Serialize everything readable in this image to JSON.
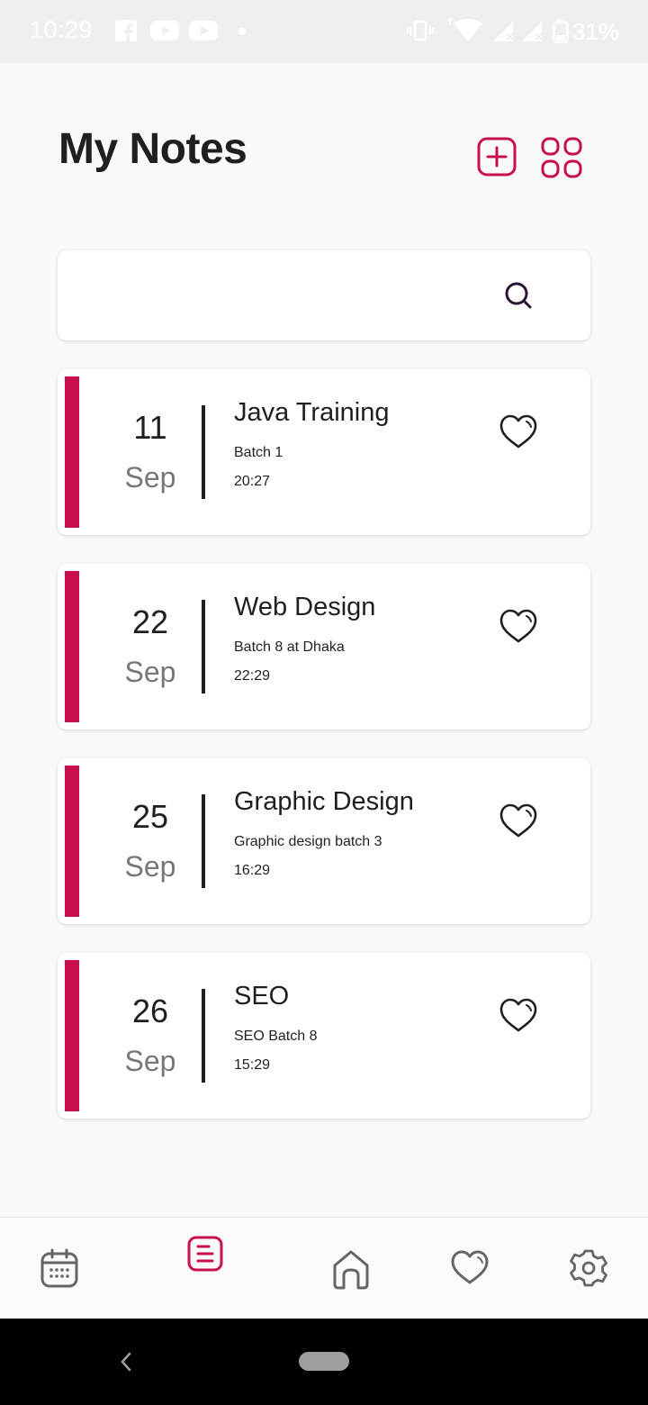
{
  "status_bar": {
    "time": "10:29",
    "battery": "31%",
    "icons": [
      "facebook-icon",
      "youtube-icon",
      "youtube-icon",
      "dot-icon",
      "vibrate-icon",
      "wifi-icon",
      "signal-icon",
      "signal-icon",
      "battery-icon"
    ]
  },
  "header": {
    "title": "My Notes",
    "add_icon": "add-square-icon",
    "grid_icon": "grid-view-icon"
  },
  "search": {
    "value": "",
    "placeholder": "",
    "icon": "search-icon"
  },
  "colors": {
    "accent": "#c8104f",
    "background": "#f9f9f9",
    "card": "#ffffff",
    "text": "#1f1f1f",
    "month_text": "#777777"
  },
  "notes": [
    {
      "day": "11",
      "month": "Sep",
      "title": "Java Training",
      "description": "Batch 1",
      "time": "20:27",
      "favorite": false
    },
    {
      "day": "22",
      "month": "Sep",
      "title": "Web Design",
      "description": "Batch 8 at Dhaka",
      "time": "22:29",
      "favorite": false
    },
    {
      "day": "25",
      "month": "Sep",
      "title": "Graphic Design",
      "description": "Graphic design batch 3",
      "time": "16:29",
      "favorite": false
    },
    {
      "day": "26",
      "month": "Sep",
      "title": "SEO",
      "description": "SEO Batch 8",
      "time": "15:29",
      "favorite": false
    }
  ],
  "bottom_nav": {
    "items": [
      {
        "icon": "calendar-icon",
        "active": false
      },
      {
        "icon": "notes-icon",
        "active": true
      },
      {
        "icon": "home-icon",
        "active": false
      },
      {
        "icon": "heart-icon",
        "active": false
      },
      {
        "icon": "settings-icon",
        "active": false
      }
    ]
  },
  "system_nav": {
    "back_icon": "back-chevron-icon",
    "home_icon": "home-pill-icon"
  }
}
